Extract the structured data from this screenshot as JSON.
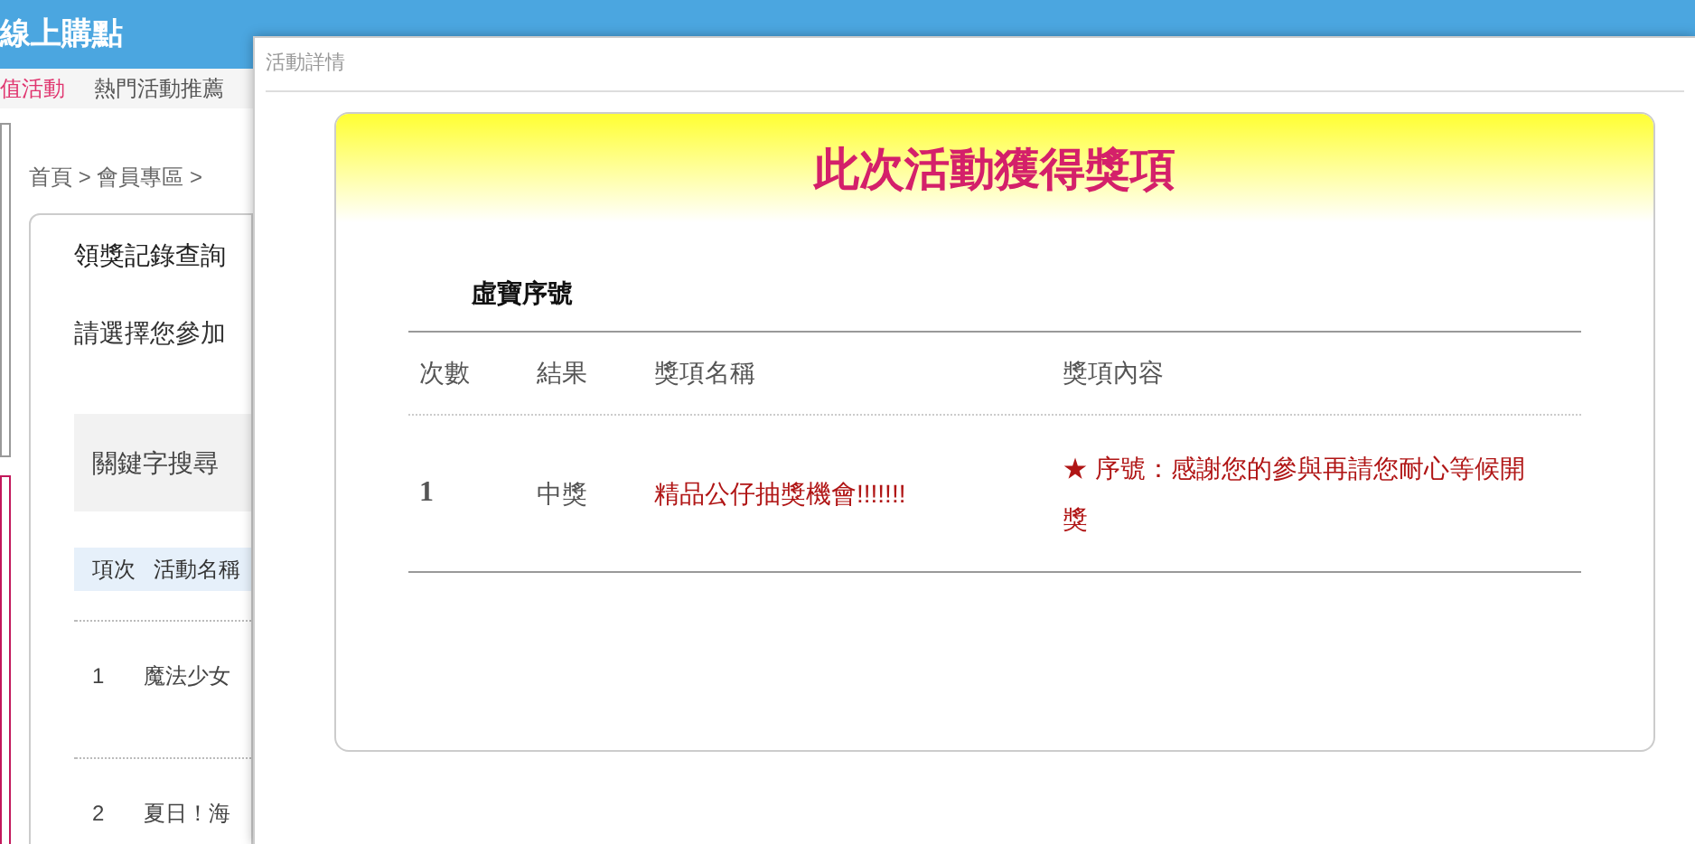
{
  "header": {
    "brand": "線上購點"
  },
  "subnav": [
    {
      "label": "值活動",
      "selected": true
    },
    {
      "label": "熱門活動推薦",
      "selected": false
    }
  ],
  "breadcrumb": "首頁 > 會員專區 >",
  "page": {
    "title": "領獎記錄查詢",
    "prompt": "請選擇您參加",
    "search_label": "關鍵字搜尋",
    "columns": [
      "項次",
      "活動名稱"
    ],
    "rows": [
      {
        "index": "1",
        "name": "魔法少女"
      },
      {
        "index": "2",
        "name": "夏日！海"
      }
    ]
  },
  "dialog": {
    "title": "活動詳情",
    "heading": "此次活動獲得獎項",
    "section": "虛寶序號",
    "columns": [
      "次數",
      "結果",
      "獎項名稱",
      "獎項內容"
    ],
    "rows": [
      {
        "count": "1",
        "result": "中獎",
        "prize": "精品公仔抽獎機會!!!!!!!",
        "content": "★ 序號：感謝您的參與再請您耐心等候開獎"
      }
    ]
  }
}
